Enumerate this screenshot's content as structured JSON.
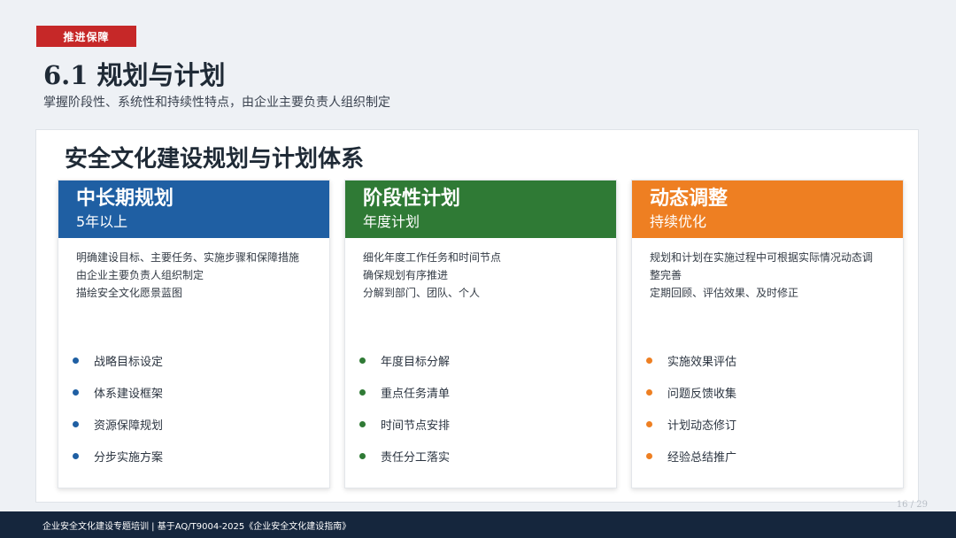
{
  "header": {
    "tag": "推进保障",
    "title": "6.1 规划与计划",
    "subtitle": "掌握阶段性、系统性和持续性特点，由企业主要负责人组织制定"
  },
  "panel": {
    "title": "安全文化建设规划与计划体系",
    "cards": [
      {
        "title": "中长期规划",
        "subtitle": "5年以上",
        "color": "#1f5fa3",
        "desc": [
          "明确建设目标、主要任务、实施步骤和保障措施",
          "由企业主要负责人组织制定",
          "描绘安全文化愿景蓝图"
        ],
        "bullets": [
          "战略目标设定",
          "体系建设框架",
          "资源保障规划",
          "分步实施方案"
        ]
      },
      {
        "title": "阶段性计划",
        "subtitle": "年度计划",
        "color": "#2f7a35",
        "desc": [
          "细化年度工作任务和时间节点",
          "确保规划有序推进",
          "分解到部门、团队、个人"
        ],
        "bullets": [
          "年度目标分解",
          "重点任务清单",
          "时间节点安排",
          "责任分工落实"
        ]
      },
      {
        "title": "动态调整",
        "subtitle": "持续优化",
        "color": "#ee7f22",
        "desc": [
          "规划和计划在实施过程中可根据实际情况动态调",
          "整完善",
          "定期回顾、评估效果、及时修正"
        ],
        "bullets": [
          "实施效果评估",
          "问题反馈收集",
          "计划动态修订",
          "经验总结推广"
        ]
      }
    ]
  },
  "footer": {
    "text": "企业安全文化建设专题培训 | 基于AQ/T9004-2025《企业安全文化建设指南》",
    "page": "16 / 29"
  },
  "colors": {
    "tag": "#c62828",
    "footer": "#15263d"
  }
}
